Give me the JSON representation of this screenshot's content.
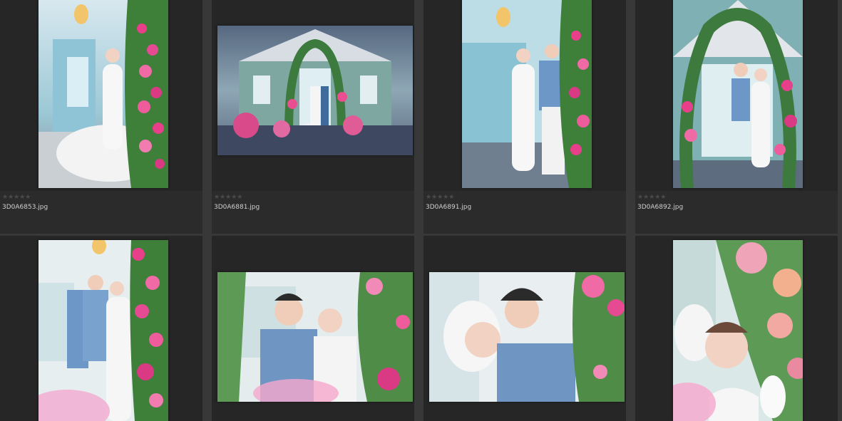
{
  "browser": {
    "items": [
      {
        "filename": "3D0A6853.jpg",
        "rating": "★★★★★",
        "orientation": "portrait"
      },
      {
        "filename": "3D0A6881.jpg",
        "rating": "★★★★★",
        "orientation": "landscape"
      },
      {
        "filename": "3D0A6891.jpg",
        "rating": "★★★★★",
        "orientation": "portrait"
      },
      {
        "filename": "3D0A6892.jpg",
        "rating": "★★★★★",
        "orientation": "portrait"
      },
      {
        "filename": "",
        "rating": "",
        "orientation": "portrait"
      },
      {
        "filename": "",
        "rating": "",
        "orientation": "landscape"
      },
      {
        "filename": "",
        "rating": "",
        "orientation": "landscape"
      },
      {
        "filename": "",
        "rating": "",
        "orientation": "portrait"
      }
    ]
  },
  "colors": {
    "background": "#383838",
    "cell": "#2b2b2b",
    "thumb_bg": "#262626",
    "filename_text": "#d0d0d0",
    "star_empty": "#4a4a4a"
  }
}
